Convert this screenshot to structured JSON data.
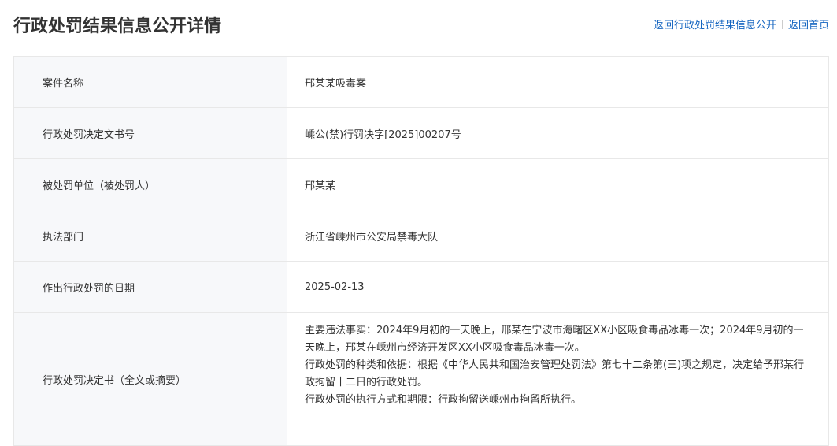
{
  "header": {
    "title": "行政处罚结果信息公开详情",
    "link_back_list": "返回行政处罚结果信息公开",
    "link_home": "返回首页"
  },
  "details": [
    {
      "label": "案件名称",
      "value": "邢某某吸毒案"
    },
    {
      "label": "行政处罚决定文书号",
      "value": "嵊公(禁)行罚决字[2025]00207号"
    },
    {
      "label": "被处罚单位（被处罚人）",
      "value": "邢某某"
    },
    {
      "label": "执法部门",
      "value": "浙江省嵊州市公安局禁毒大队"
    },
    {
      "label": "作出行政处罚的日期",
      "value": "2025-02-13"
    },
    {
      "label": "行政处罚决定书（全文或摘要）",
      "paragraphs": [
        "主要违法事实：2024年9月初的一天晚上，邢某在宁波市海曙区XX小区吸食毒品冰毒一次；2024年9月初的一天晚上，邢某在嵊州市经济开发区XX小区吸食毒品冰毒一次。",
        "行政处罚的种类和依据：根据《中华人民共和国治安管理处罚法》第七十二条第(三)项之规定，决定给予邢某行政拘留十二日的行政处罚。",
        "行政处罚的执行方式和期限：行政拘留送嵊州市拘留所执行。"
      ]
    }
  ]
}
